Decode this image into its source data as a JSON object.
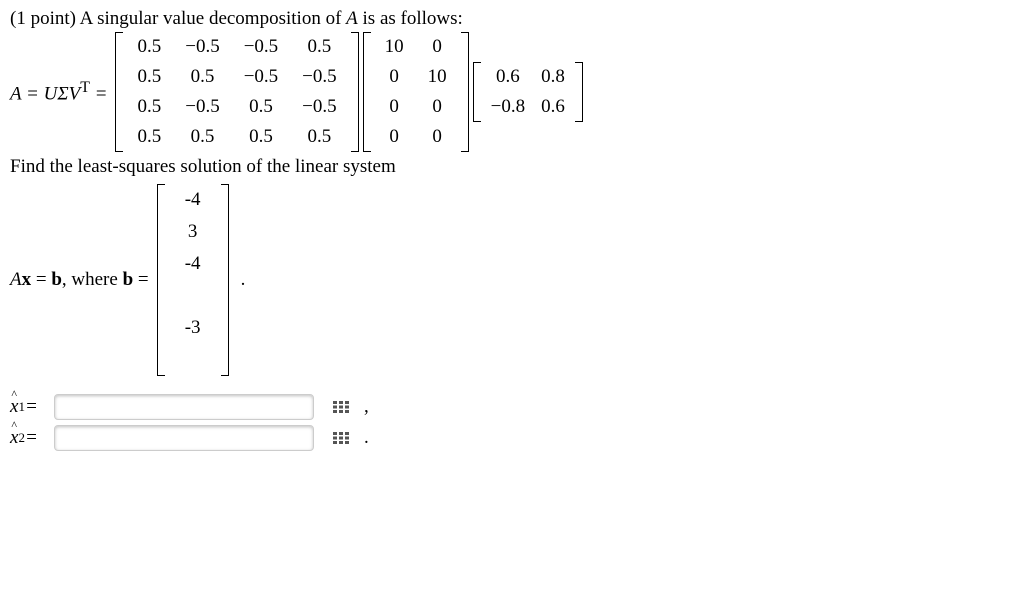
{
  "problem": {
    "points_prefix": "(1 point) A singular value decomposition of ",
    "A": "A",
    "follows": " is as follows:"
  },
  "svd": {
    "lhs": "A = UΣVᵀ =",
    "U": [
      [
        "0.5",
        "−0.5",
        "−0.5",
        "0.5"
      ],
      [
        "0.5",
        "0.5",
        "−0.5",
        "−0.5"
      ],
      [
        "0.5",
        "−0.5",
        "0.5",
        "−0.5"
      ],
      [
        "0.5",
        "0.5",
        "0.5",
        "0.5"
      ]
    ],
    "Sigma": [
      [
        "10",
        "0"
      ],
      [
        "0",
        "10"
      ],
      [
        "0",
        "0"
      ],
      [
        "0",
        "0"
      ]
    ],
    "Vt": [
      [
        "0.6",
        "0.8"
      ],
      [
        "−0.8",
        "0.6"
      ]
    ]
  },
  "system_line": "Find the least-squares solution of the linear system",
  "b_eq": {
    "lhs": "Ax = b, where b =",
    "b": [
      "-4",
      "3",
      "-4",
      "",
      "-3",
      ""
    ],
    "trail": "."
  },
  "answers": {
    "x1_label": "x",
    "x1_sub": "1",
    "x2_label": "x",
    "x2_sub": "2",
    "eq": " =",
    "x1_value": "",
    "x2_value": "",
    "sep": ",",
    "end": "."
  },
  "chart_data": {
    "type": "table",
    "title": "SVD matrices and vector b",
    "matrices": {
      "U": [
        [
          0.5,
          -0.5,
          -0.5,
          0.5
        ],
        [
          0.5,
          0.5,
          -0.5,
          -0.5
        ],
        [
          0.5,
          -0.5,
          0.5,
          -0.5
        ],
        [
          0.5,
          0.5,
          0.5,
          0.5
        ]
      ],
      "Sigma": [
        [
          10,
          0
        ],
        [
          0,
          10
        ],
        [
          0,
          0
        ],
        [
          0,
          0
        ]
      ],
      "Vt": [
        [
          0.6,
          0.8
        ],
        [
          -0.8,
          0.6
        ]
      ],
      "b": [
        -4,
        3,
        -4,
        null,
        -3,
        null
      ]
    }
  }
}
